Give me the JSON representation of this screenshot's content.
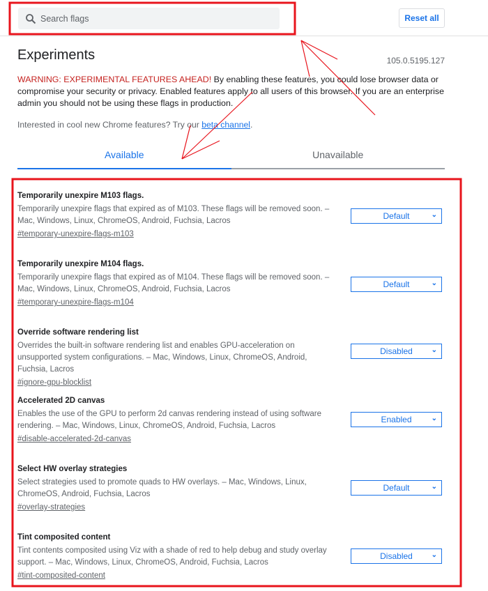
{
  "header": {
    "search_placeholder": "Search flags",
    "search_value": "",
    "reset_label": "Reset all"
  },
  "page": {
    "title": "Experiments",
    "version": "105.0.5195.127",
    "warning_prefix": "WARNING: EXPERIMENTAL FEATURES AHEAD!",
    "warning_body": " By enabling these features, you could lose browser data or compromise your security or privacy. Enabled features apply to all users of this browser. If you are an enterprise admin you should not be using these flags in production.",
    "interest_text": "Interested in cool new Chrome features? Try our ",
    "interest_link": "beta channel",
    "interest_end": "."
  },
  "tabs": [
    {
      "label": "Available",
      "active": true
    },
    {
      "label": "Unavailable",
      "active": false
    }
  ],
  "flags": [
    {
      "title": "Temporarily unexpire M103 flags.",
      "desc": "Temporarily unexpire flags that expired as of M103. These flags will be removed soon. – Mac, Windows, Linux, ChromeOS, Android, Fuchsia, Lacros",
      "link": "#temporary-unexpire-flags-m103",
      "value": "Default"
    },
    {
      "title": "Temporarily unexpire M104 flags.",
      "desc": "Temporarily unexpire flags that expired as of M104. These flags will be removed soon. – Mac, Windows, Linux, ChromeOS, Android, Fuchsia, Lacros",
      "link": "#temporary-unexpire-flags-m104",
      "value": "Default"
    },
    {
      "title": "Override software rendering list",
      "desc": "Overrides the built-in software rendering list and enables GPU-acceleration on unsupported system configurations. – Mac, Windows, Linux, ChromeOS, Android, Fuchsia, Lacros",
      "link": "#ignore-gpu-blocklist",
      "value": "Disabled"
    },
    {
      "title": "Accelerated 2D canvas",
      "desc": "Enables the use of the GPU to perform 2d canvas rendering instead of using software rendering. – Mac, Windows, Linux, ChromeOS, Android, Fuchsia, Lacros",
      "link": "#disable-accelerated-2d-canvas",
      "value": "Enabled"
    },
    {
      "title": "Select HW overlay strategies",
      "desc": "Select strategies used to promote quads to HW overlays. – Mac, Windows, Linux, ChromeOS, Android, Fuchsia, Lacros",
      "link": "#overlay-strategies",
      "value": "Default"
    },
    {
      "title": "Tint composited content",
      "desc": "Tint contents composited using Viz with a shade of red to help debug and study overlay support. – Mac, Windows, Linux, ChromeOS, Android, Fuchsia, Lacros",
      "link": "#tint-composited-content",
      "value": "Disabled"
    }
  ],
  "colors": {
    "accent": "#1a73e8",
    "warning": "#c5221f",
    "annotation": "#e8141c"
  }
}
